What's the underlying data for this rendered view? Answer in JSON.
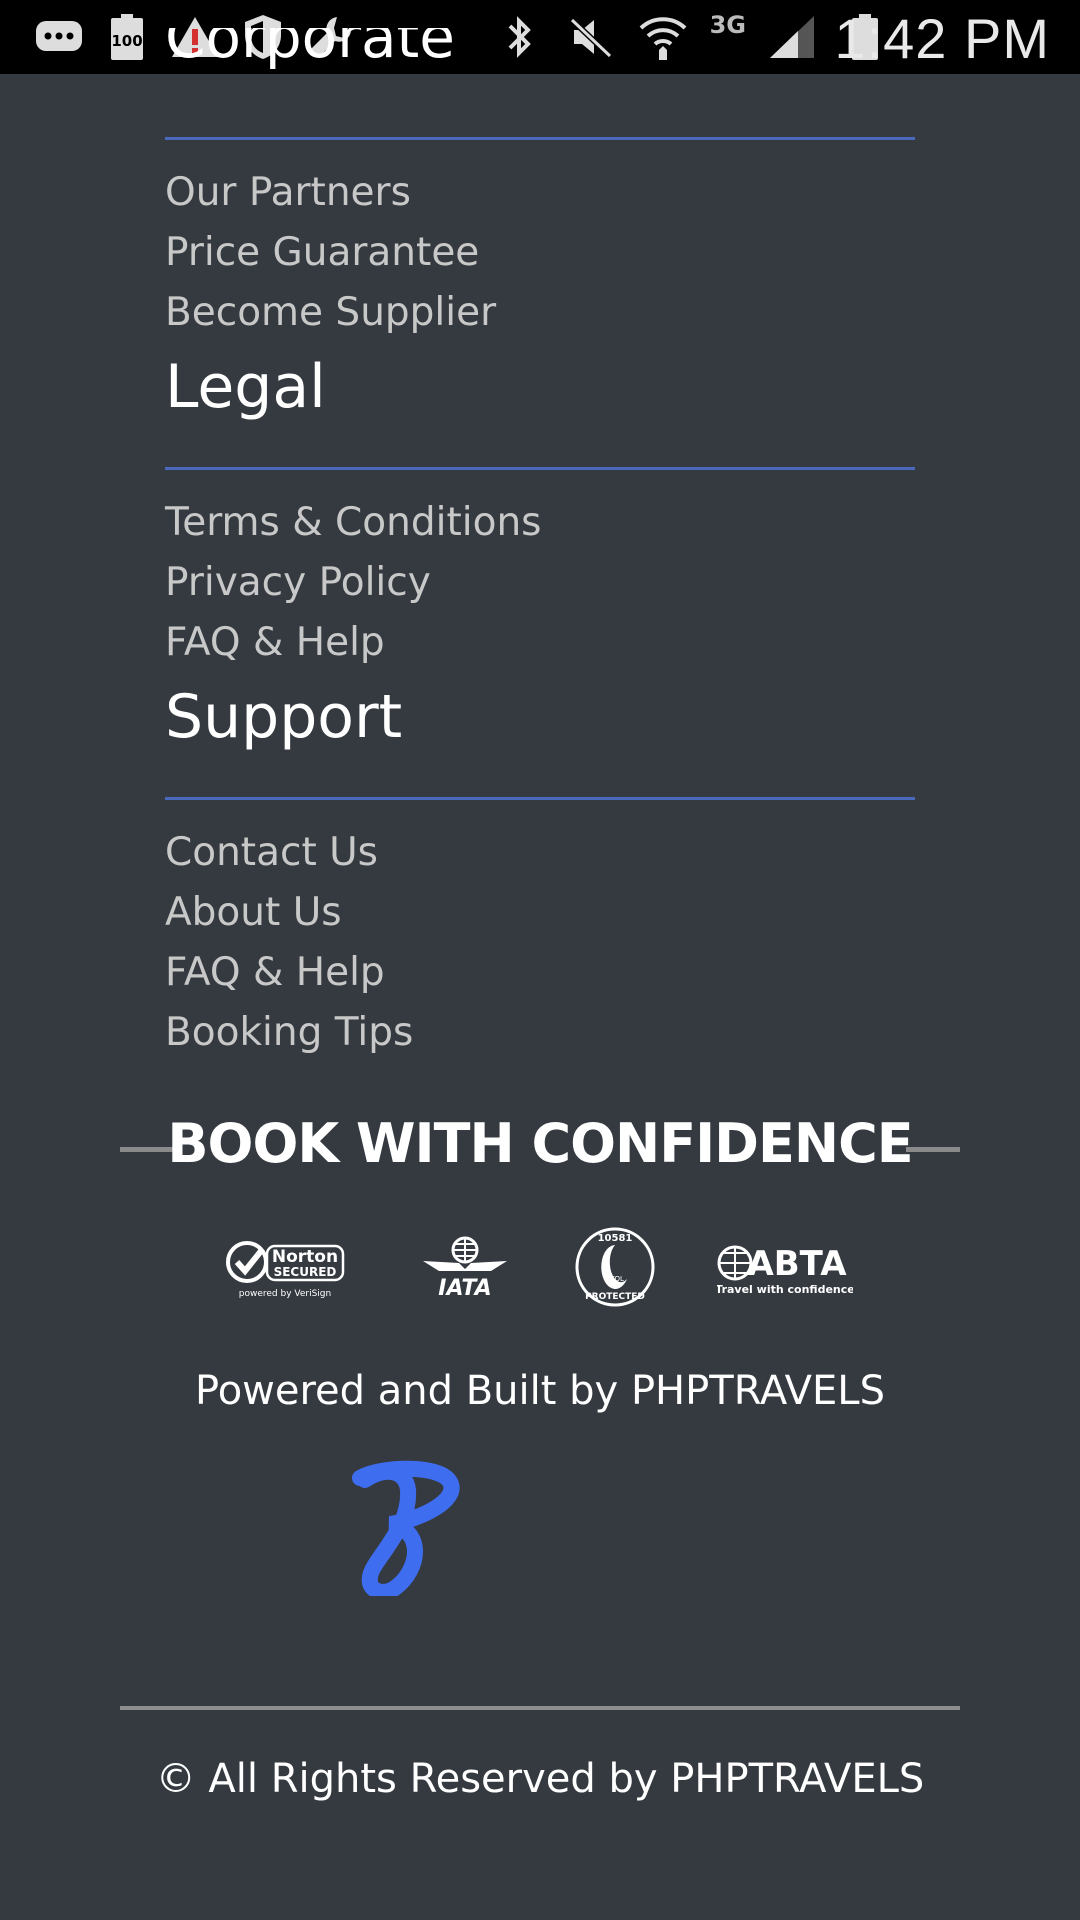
{
  "status_bar": {
    "time": "1:42 PM",
    "network": "3G",
    "battery_level_text": "100"
  },
  "corporate": {
    "heading": "Corporate",
    "links": [
      "Our Partners",
      "Price Guarantee",
      "Become Supplier"
    ]
  },
  "legal": {
    "heading": "Legal",
    "links": [
      "Terms & Conditions",
      "Privacy Policy",
      "FAQ & Help"
    ]
  },
  "support": {
    "heading": "Support",
    "links": [
      "Contact Us",
      "About Us",
      "FAQ & Help",
      "Booking Tips"
    ]
  },
  "confidence": {
    "title": "BOOK WITH CONFIDENCE",
    "badges": [
      {
        "name": "norton-secured-logo",
        "line1": "Norton",
        "line2": "SECURED",
        "line3": "powered by VeriSign"
      },
      {
        "name": "iata-logo",
        "line1": "IATA"
      },
      {
        "name": "atol-protected-logo",
        "line1": "10581",
        "line2": "ATOL",
        "line3": "PROTECTED"
      },
      {
        "name": "abta-logo",
        "line1": "ABTA",
        "line2": "Travel with confidence"
      }
    ]
  },
  "footer": {
    "powered_by": "Powered and Built by PHPTRAVELS",
    "copyright": "© All Rights Reserved by PHPTRAVELS"
  },
  "colors": {
    "background": "#343a40",
    "accent_line": "#4a69bd",
    "brand_logo": "#3f6df0"
  }
}
